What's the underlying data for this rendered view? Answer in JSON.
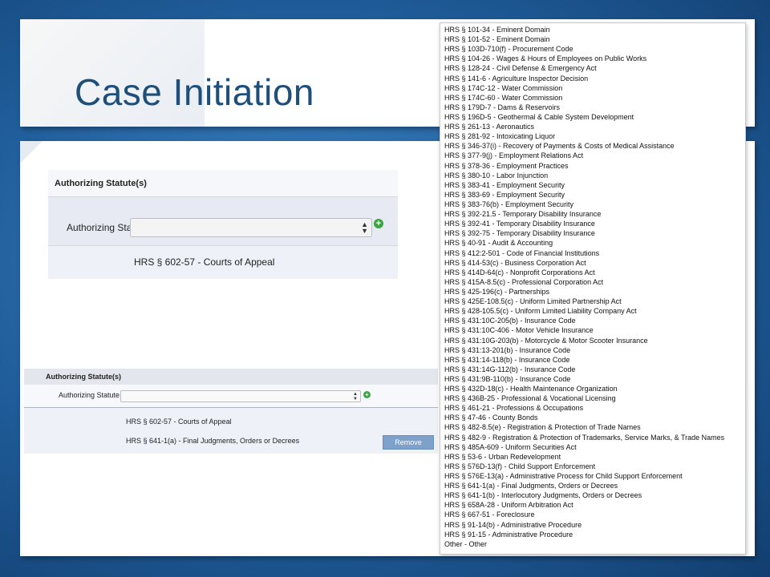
{
  "slide": {
    "title": "Case Initiation"
  },
  "panel_top": {
    "header": "Authorizing Statute(s)",
    "field_label": "Authorizing Statute",
    "select_value": "",
    "statutes": [
      "HRS § 602-57 - Courts of Appeal"
    ]
  },
  "panel_bottom": {
    "header": "Authorizing Statute(s)",
    "field_label": "Authorizing Statute",
    "select_value": "",
    "statutes": [
      "HRS § 602-57 - Courts of Appeal",
      "HRS § 641-1(a) - Final Judgments, Orders or Decrees"
    ],
    "remove_label": "Remove"
  },
  "icons": {
    "add": "plus-circle-icon",
    "select_arrows": "up-down-arrow-icon"
  },
  "colors": {
    "accent_blue": "#1e4e7a",
    "add_green": "#3aa640",
    "remove_button": "#7ea1cc"
  },
  "dropdown_options": [
    "HRS § 101-34 - Eminent Domain",
    "HRS § 101-52 - Eminent Domain",
    "HRS § 103D-710(f) - Procurement Code",
    "HRS § 104-26 - Wages & Hours of Employees on Public Works",
    "HRS § 128-24 - Civil Defense & Emergency Act",
    "HRS § 141-6 - Agriculture Inspector Decision",
    "HRS § 174C-12 - Water Commission",
    "HRS § 174C-60 - Water Commission",
    "HRS § 179D-7 - Dams & Reservoirs",
    "HRS § 196D-5 - Geothermal & Cable System Development",
    "HRS § 261-13 - Aeronautics",
    "HRS § 281-92 - Intoxicating Liquor",
    "HRS § 346-37(i) - Recovery of Payments & Costs of Medical Assistance",
    "HRS § 377-9(j) - Employment Relations Act",
    "HRS § 378-36 - Employment Practices",
    "HRS § 380-10 - Labor Injunction",
    "HRS § 383-41 - Employment Security",
    "HRS § 383-69 - Employment Security",
    "HRS § 383-76(b) - Employment Security",
    "HRS § 392-21.5 - Temporary Disability Insurance",
    "HRS § 392-41 - Temporary Disability Insurance",
    "HRS § 392-75 - Temporary Disability Insurance",
    "HRS § 40-91 - Audit & Accounting",
    "HRS § 412:2-501 - Code of Financial Institutions",
    "HRS § 414-53(c) - Business Corporation Act",
    "HRS § 414D-64(c) - Nonprofit Corporations Act",
    "HRS § 415A-8.5(c) - Professional Corporation Act",
    "HRS § 425-196(c) - Partnerships",
    "HRS § 425E-108.5(c) - Uniform Limited Partnership Act",
    "HRS § 428-105.5(c) - Uniform Limited Liability Company Act",
    "HRS § 431:10C-205(b) - Insurance Code",
    "HRS § 431:10C-406 - Motor Vehicle Insurance",
    "HRS § 431:10G-203(b) - Motorcycle & Motor Scooter Insurance",
    "HRS § 431:13-201(b) - Insurance Code",
    "HRS § 431:14-118(b) - Insurance Code",
    "HRS § 431:14G-112(b) - Insurance Code",
    "HRS § 431:9B-110(b) - Insurance Code",
    "HRS § 432D-18(c) - Health Maintenance Organization",
    "HRS § 436B-25 - Professional & Vocational Licensing",
    "HRS § 461-21 - Professions & Occupations",
    "HRS § 47-46 - County Bonds",
    "HRS § 482-8.5(e) - Registration & Protection of Trade Names",
    "HRS § 482-9 - Registration & Protection of Trademarks, Service Marks, & Trade Names",
    "HRS § 485A-609 - Uniform Securities Act",
    "HRS § 53-6 - Urban Redevelopment",
    "HRS § 576D-13(f) - Child Support Enforcement",
    "HRS § 576E-13(a) - Administrative Process for Child Support Enforcement",
    "HRS § 641-1(a) - Final Judgments, Orders or Decrees",
    "HRS § 641-1(b) - Interlocutory Judgments, Orders or Decrees",
    "HRS § 658A-28 - Uniform Arbitration Act",
    "HRS § 667-51 - Foreclosure",
    "HRS § 91-14(b) - Administrative Procedure",
    "HRS § 91-15 - Administrative Procedure",
    "Other - Other"
  ]
}
